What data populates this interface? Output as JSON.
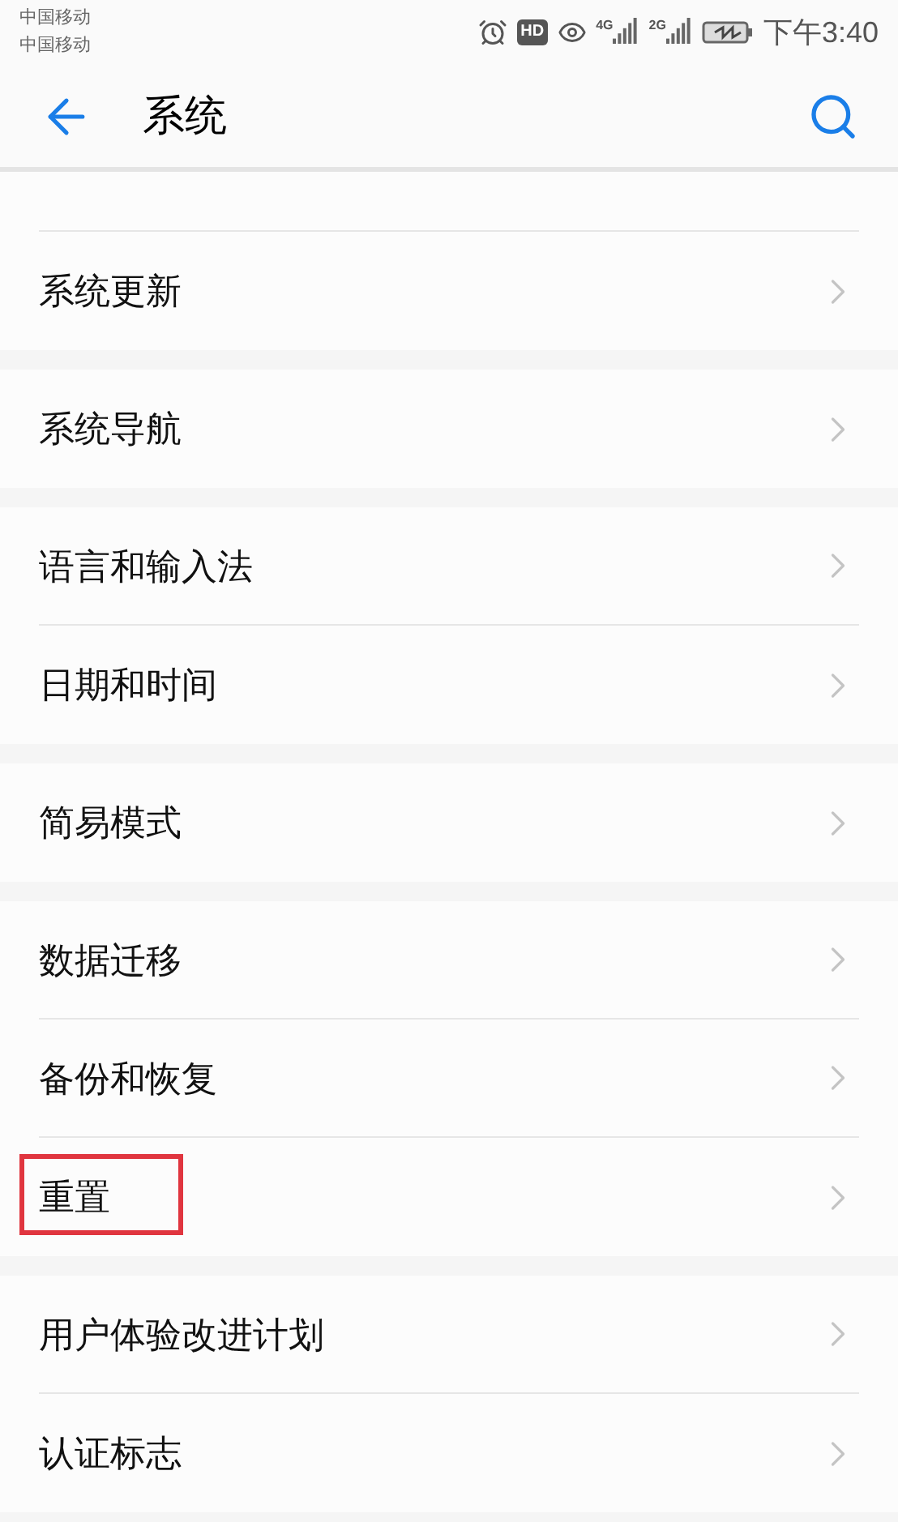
{
  "status_bar": {
    "carriers": [
      "中国移动",
      "中国移动"
    ],
    "hd_badge": "HD",
    "networks": [
      "4G",
      "2G"
    ],
    "time": "下午3:40"
  },
  "header": {
    "title": "系统"
  },
  "groups": [
    {
      "items": [
        {
          "label": "系统更新",
          "highlighted": false
        }
      ]
    },
    {
      "items": [
        {
          "label": "系统导航",
          "highlighted": false
        }
      ]
    },
    {
      "items": [
        {
          "label": "语言和输入法",
          "highlighted": false
        },
        {
          "label": "日期和时间",
          "highlighted": false
        }
      ]
    },
    {
      "items": [
        {
          "label": "简易模式",
          "highlighted": false
        }
      ]
    },
    {
      "items": [
        {
          "label": "数据迁移",
          "highlighted": false
        },
        {
          "label": "备份和恢复",
          "highlighted": false
        },
        {
          "label": "重置",
          "highlighted": true
        }
      ]
    },
    {
      "items": [
        {
          "label": "用户体验改进计划",
          "highlighted": false
        },
        {
          "label": "认证标志",
          "highlighted": false
        }
      ]
    }
  ]
}
